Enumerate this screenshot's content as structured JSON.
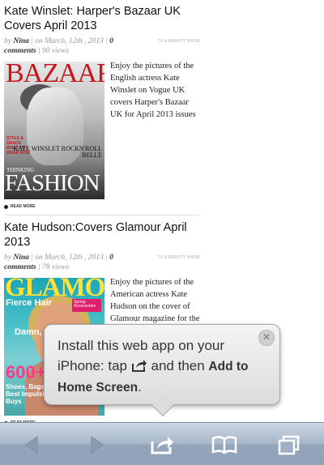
{
  "posts": [
    {
      "title": "Kate Winslet: Harper's Bazaar UK Covers April 2013",
      "by": "by",
      "author": "Nina",
      "date": "| on March, 12th , 2013",
      "sep": "|",
      "comments_count": "0",
      "comments_label": "comments",
      "views": "| 90 views",
      "category": "TV & BEAUTY SHOW",
      "excerpt": "Enjoy the pictures of the English actress Kate Winslet on Vogue UK covers Harper's Bazaar UK for April 2013 issues",
      "read_more": "READ MORE",
      "cover": {
        "masthead": "BAZAAR",
        "side_text": "STYLE & GRACE WHAT TO WEAR NOW",
        "name": "KATE WINSLET ROCKN'ROLL BELLE",
        "kicker": "THINKING",
        "headline": "FASHION"
      }
    },
    {
      "title": "Kate Hudson:Covers Glamour April 2013",
      "by": "by",
      "author": "Nina",
      "date": "| on March, 12th , 2013",
      "sep": "|",
      "comments_count": "0",
      "comments_label": "comments",
      "views": "| 78 views",
      "category": "TV & BEAUTY SHOW",
      "excerpt": "Enjoy the pictures of the American actress Kate Hudson on the cover of Glamour magazine for the April 2013 issue",
      "read_more": "READ MORE",
      "cover": {
        "masthead": "GLAMOUR",
        "fierce": "Fierce Hair",
        "damn": "Damn, Kiss, Yourself",
        "badge": "Spring Accessories",
        "big_number": "600+",
        "shoes": "Shoes, Bags & Best Impulsive Buys"
      }
    }
  ],
  "popover": {
    "line1": "Install this web app on your iPhone: tap",
    "line2": "and then",
    "bold": "Add to Home Screen",
    "end": ".",
    "close": "✕"
  },
  "toolbar": {
    "back": "back-icon",
    "forward": "forward-icon",
    "share": "share-icon",
    "bookmarks": "bookmarks-icon",
    "tabs": "tabs-icon"
  }
}
